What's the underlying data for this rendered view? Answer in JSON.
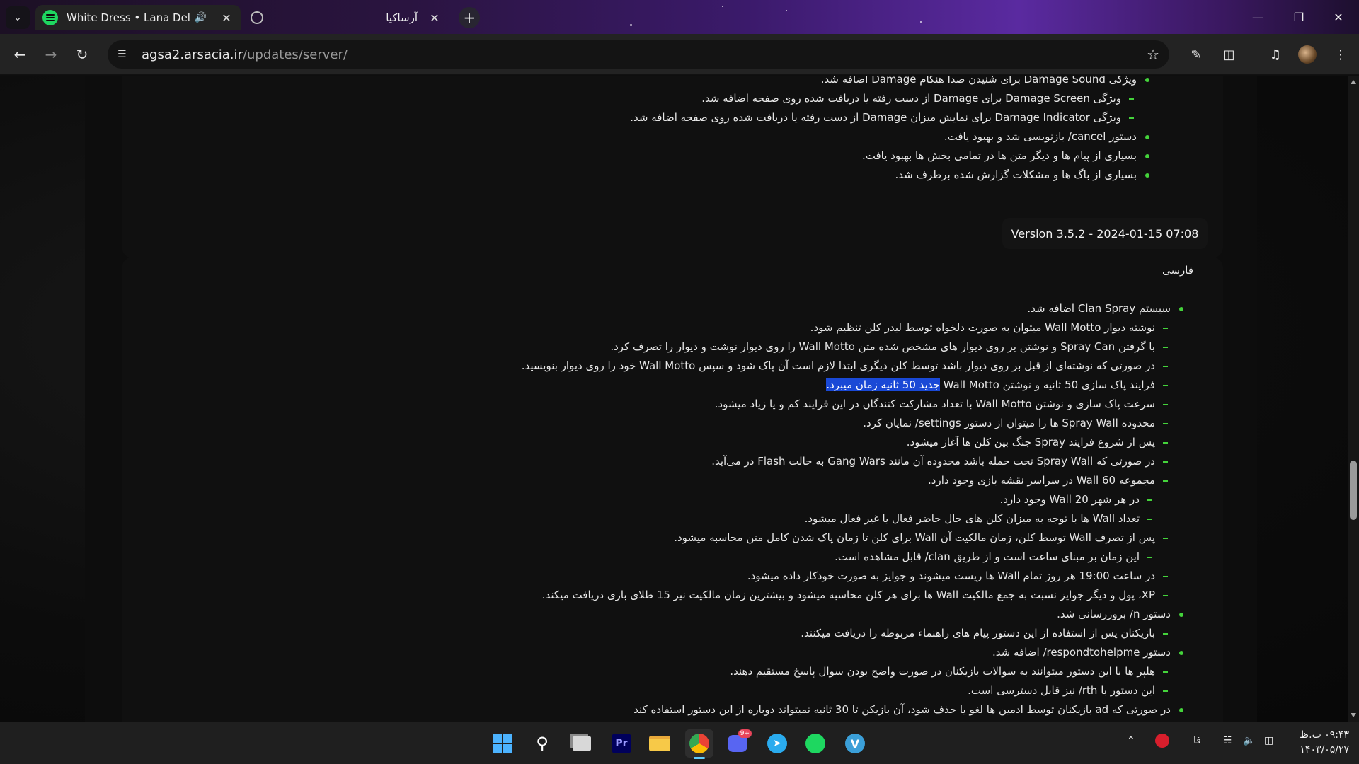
{
  "browser": {
    "tabs": [
      {
        "title": "White Dress • Lana Del Rey",
        "icon": "spotify-icon",
        "active": true,
        "audio": true
      },
      {
        "title": "آرساکیا",
        "icon": "globe-icon",
        "active": false
      }
    ],
    "address": {
      "host": "agsa2.arsacia.ir",
      "path": "/updates/server/"
    }
  },
  "page": {
    "prev_items": [
      {
        "level": 1,
        "text": "ویژگی Damage Sound برای شنیدن صدا هنگام Damage اضافه شد."
      },
      {
        "level": 2,
        "text": "ویژگی Damage Screen برای Damage از دست رفته یا دریافت شده روی صفحه اضافه شد."
      },
      {
        "level": 2,
        "text": "ویژگی Damage Indicator برای نمایش میزان Damage از دست رفته یا دریافت شده روی صفحه اضافه شد."
      },
      {
        "level": 1,
        "text": "دستور cancel/ بازنویسی شد و بهبود یافت."
      },
      {
        "level": 1,
        "text": "بسیاری از پیام ها و دیگر متن ها در تمامی بخش ها بهبود یافت."
      },
      {
        "level": 1,
        "text": "بسیاری از باگ ها و مشکلات گزارش شده برطرف شد."
      }
    ],
    "version_label": "Version 3.5.2 - 2024-01-15 07:08",
    "language": "فارسی",
    "items": [
      {
        "level": 1,
        "text": "سیستم Clan Spray اضافه شد."
      },
      {
        "level": 2,
        "text": "نوشته دیوار Wall Motto میتوان به صورت دلخواه توسط لیدر کلن تنظیم شود."
      },
      {
        "level": 2,
        "text": "با گرفتن Spray Can و نوشتن بر روی دیوار های مشخص شده متن Wall Motto را روی دیوار نوشت و دیوار را تصرف کرد."
      },
      {
        "level": 2,
        "text": "در صورتی که نوشته‌ای از قبل بر روی دیوار باشد توسط کلن دیگری ابتدا لازم است آن پاک شود و سپس Wall Motto خود را روی دیوار بنویسید."
      },
      {
        "level": 2,
        "text": "فرایند پاک سازی 50 ثانیه و نوشتن Wall Motto ",
        "highlight": "جدید 50 ثانیه زمان میبرد."
      },
      {
        "level": 2,
        "text": "سرعت پاک سازی و نوشتن Wall Motto با تعداد مشارکت کنندگان در این فرایند کم و یا زیاد میشود."
      },
      {
        "level": 2,
        "text": "محدوده Spray Wall ها را میتوان از دستور settings/ نمایان کرد."
      },
      {
        "level": 2,
        "text": "پس از شروع فرایند Spray جنگ بین کلن ها آغاز میشود."
      },
      {
        "level": 2,
        "text": "در صورتی که Spray Wall تحت حمله باشد محدوده آن مانند Gang Wars به حالت Flash در می‌آید."
      },
      {
        "level": 2,
        "text": "مجموعه 60 Wall در سراسر نقشه بازی وجود دارد."
      },
      {
        "level": 3,
        "text": "در هر شهر 20 Wall وجود دارد."
      },
      {
        "level": 3,
        "text": "تعداد Wall ها با توجه به میزان کلن های حال حاضر فعال یا غیر فعال میشود."
      },
      {
        "level": 2,
        "text": "پس از تصرف Wall توسط کلن، زمان مالکیت آن Wall برای کلن تا زمان پاک شدن کامل متن محاسبه میشود."
      },
      {
        "level": 3,
        "text": "این زمان بر مبنای ساعت است و از طریق clan/ قابل مشاهده است."
      },
      {
        "level": 2,
        "text": "در ساعت 19:00 هر روز تمام Wall ها ریست میشوند و جوایز به صورت خودکار داده میشود."
      },
      {
        "level": 2,
        "text": "XP، پول و دیگر جوایز نسبت به جمع مالکیت Wall ها برای هر کلن محاسبه میشود و بیشترین زمان مالکیت نیز 15 طلای بازی دریافت میکند."
      },
      {
        "level": 1,
        "text": "دستور n/ بروزرسانی شد."
      },
      {
        "level": 2,
        "text": "بازیکنان پس از استفاده از این دستور پیام های راهنماء مربوطه را دریافت میکنند."
      },
      {
        "level": 1,
        "text": "دستور respondtohelpme/ اضافه شد."
      },
      {
        "level": 2,
        "text": "هلپر ها با این دستور میتوانند به سوالات بازیکنان در صورت واضح بودن سوال پاسخ مستقیم دهند."
      },
      {
        "level": 2,
        "text": "این دستور با rth/ نیز قابل دسترسی است."
      },
      {
        "level": 1,
        "text": "در صورتی که ad بازیکنان توسط ادمین ها لغو یا حذف شود، آن بازیکن تا 30 ثانیه نمیتواند دوباره از این دستور استفاده کند"
      }
    ]
  },
  "taskbar": {
    "apps": [
      "windows-start",
      "search",
      "task-view",
      "premiere-pro",
      "file-explorer",
      "chrome",
      "discord",
      "telegram",
      "spotify",
      "v-app"
    ],
    "discord_badge": "9+",
    "input_language": "فا",
    "time": "۰۹:۴۳ ب.ظ",
    "date": "۱۴۰۳/۰۵/۲۷"
  },
  "colors": {
    "accent_green": "#44d33b",
    "selection": "#1a49d6",
    "spotify": "#1ed760"
  }
}
